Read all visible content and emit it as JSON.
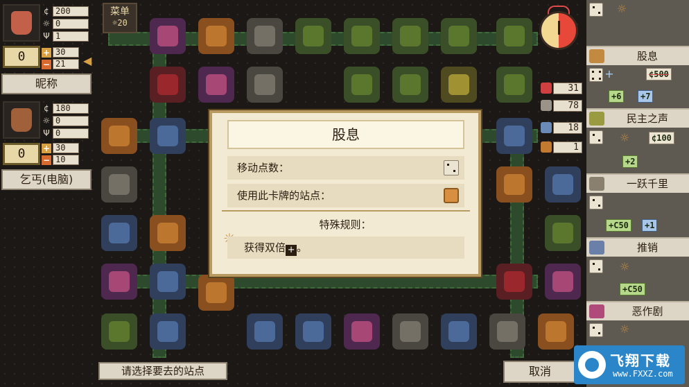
{
  "menu": {
    "label": "菜单",
    "count": "20"
  },
  "players": [
    {
      "money": "200",
      "stat2": "0",
      "stat3": "1",
      "score": "0",
      "plus": "30",
      "minus": "21",
      "name": "昵称"
    },
    {
      "money": "180",
      "stat2": "0",
      "stat3": "0",
      "score": "0",
      "plus": "30",
      "minus": "10",
      "name": "乞丐(电脑)"
    }
  ],
  "counters": [
    "31",
    "78",
    "18",
    "1"
  ],
  "cards": [
    {
      "name": "股息"
    },
    {
      "price": "500",
      "chip1": "+6",
      "chip2": "+7",
      "name": "民主之声"
    },
    {
      "price": "100",
      "chip1": "+2",
      "name": "一跃千里"
    },
    {
      "chip1": "+C50",
      "chip2": "+1",
      "name": "推销"
    },
    {
      "chip1": "+C50",
      "name": "恶作剧"
    }
  ],
  "dialog": {
    "title": "股息",
    "row1": "移动点数：",
    "row2": "使用此卡牌的站点：",
    "section": "特殊规则：",
    "rule": "获得双倍",
    "rule_suffix": "。"
  },
  "hint": "请选择要去的站点",
  "cancel": "取消",
  "watermark": {
    "title": "飞翔下载",
    "url": "www.FXXZ.com"
  },
  "colors": {
    "panel": "#f3ead4",
    "accent": "#c28a40",
    "board_bg": "#1c1815"
  }
}
